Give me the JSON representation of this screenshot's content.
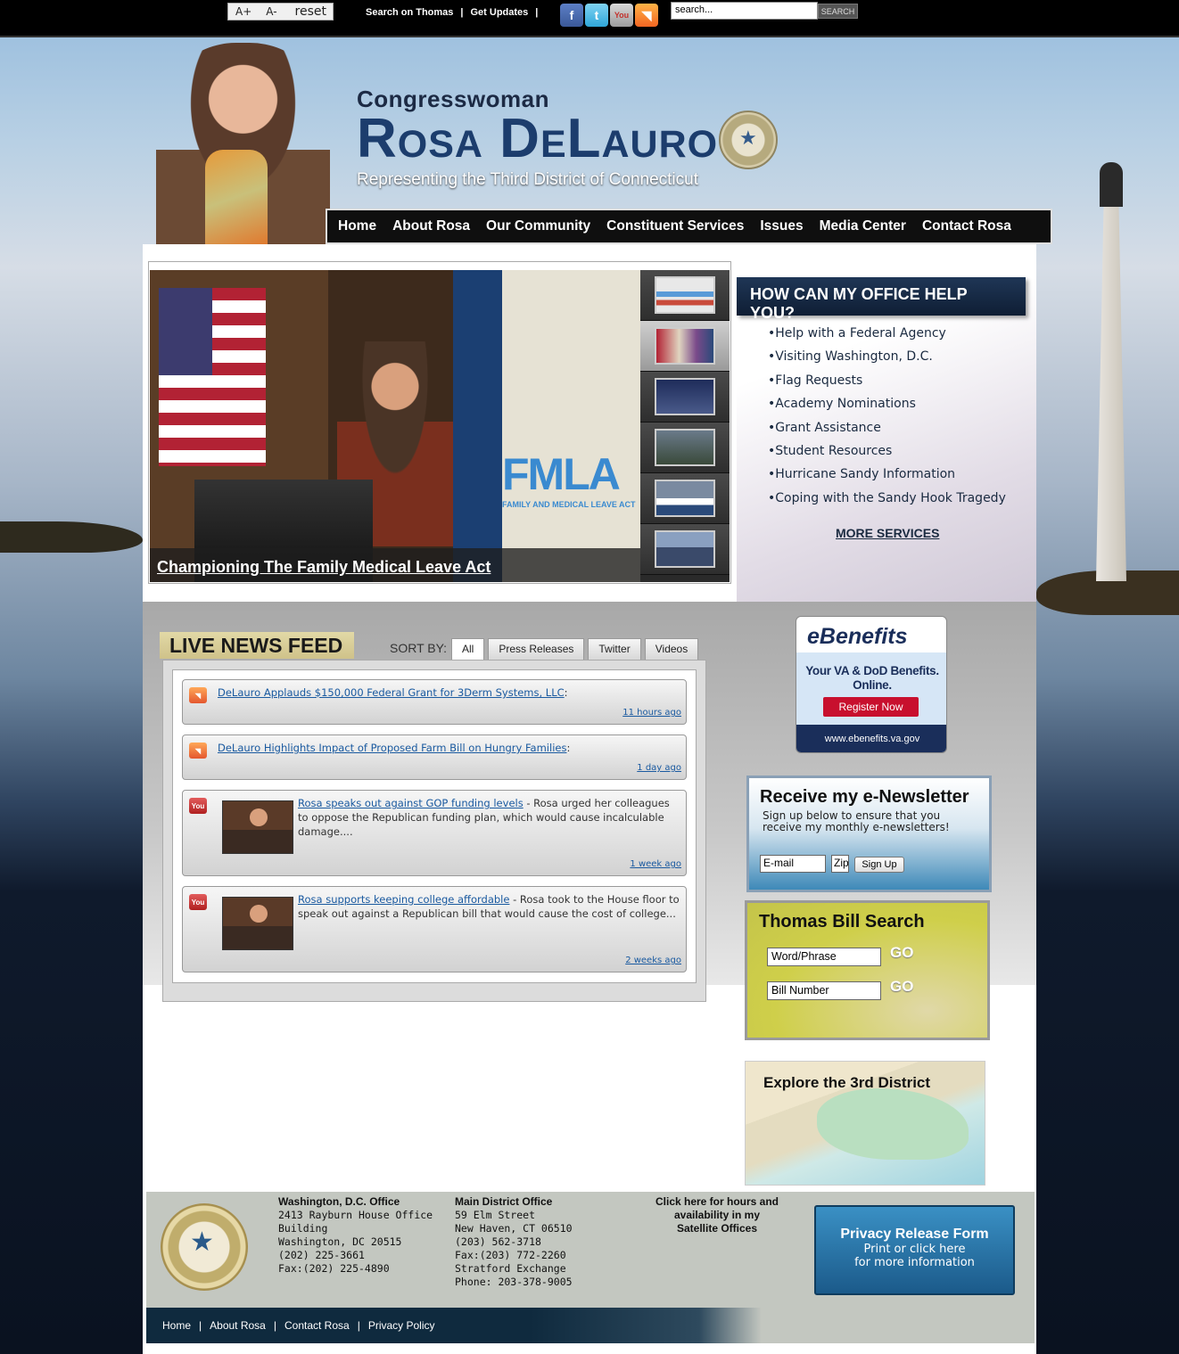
{
  "topbar": {
    "font_increase": "A+",
    "font_decrease": "A-",
    "font_reset": "reset",
    "links": [
      "Search on Thomas",
      "Get Updates"
    ],
    "social": [
      "facebook-icon",
      "twitter-icon",
      "youtube-icon",
      "rss-icon"
    ],
    "search_value": "search...",
    "search_button": "SEARCH"
  },
  "header": {
    "pre_title": "Congresswoman",
    "name": "Rosa DeLauro",
    "subtitle": "Representing the Third District of Connecticut"
  },
  "nav": [
    "Home",
    "About Rosa",
    "Our Community",
    "Constituent Services",
    "Issues",
    "Media Center",
    "Contact Rosa"
  ],
  "slideshow": {
    "caption": "Championing The Family Medical Leave Act",
    "overlay_text": "FMLA",
    "overlay_sub": "FAMILY AND MEDICAL LEAVE ACT",
    "thumbnails": 6,
    "active_thumb": 2
  },
  "help": {
    "title": "HOW CAN MY OFFICE HELP YOU?",
    "items": [
      "Help with a Federal Agency",
      "Visiting Washington, D.C.",
      "Flag Requests",
      "Academy Nominations",
      "Grant Assistance",
      "Student Resources",
      "Hurricane Sandy Information",
      "Coping with the Sandy Hook Tragedy"
    ],
    "more": "MORE SERVICES"
  },
  "newsfeed": {
    "title": "LIVE NEWS FEED",
    "sort_label": "SORT BY:",
    "tabs": [
      "All",
      "Press Releases",
      "Twitter",
      "Videos"
    ],
    "items": [
      {
        "type": "rss",
        "link": "DeLauro Applauds $150,000 Federal Grant for 3Derm Systems, LLC",
        "suffix": ":",
        "time": "11 hours ago"
      },
      {
        "type": "rss",
        "link": "DeLauro Highlights Impact of Proposed Farm Bill on Hungry Families",
        "suffix": ":",
        "time": "1 day ago"
      },
      {
        "type": "video",
        "link": "Rosa speaks out against GOP funding levels",
        "desc": " - Rosa urged her colleagues to oppose the Republican funding plan, which would cause incalculable damage....",
        "time": "1 week ago"
      },
      {
        "type": "video",
        "link": "Rosa supports keeping college affordable",
        "desc": " - Rosa took to the House floor to speak out against a Republican bill that would cause the cost of college...",
        "time": "2 weeks ago"
      }
    ]
  },
  "ebenefits": {
    "logo": "eBenefits",
    "tagline": "Your VA & DoD Benefits. Online.",
    "button": "Register Now",
    "url": "www.ebenefits.va.gov"
  },
  "newsletter": {
    "title": "Receive my e-Newsletter",
    "subtitle": "Sign up below to ensure that you receive my monthly e-newsletters!",
    "email_placeholder": "E-mail",
    "zip_placeholder": "Zip",
    "button": "Sign Up"
  },
  "bill_search": {
    "title": "Thomas Bill Search",
    "phrase_value": "Word/Phrase",
    "number_value": "Bill Number",
    "go": "GO"
  },
  "explore": {
    "title": "Explore the 3rd District"
  },
  "footer": {
    "dc": {
      "title": "Washington, D.C. Office",
      "lines": [
        "2413 Rayburn House Office",
        "Building",
        "Washington, DC 20515",
        "(202) 225-3661",
        "Fax:(202) 225-4890"
      ]
    },
    "district": {
      "title": "Main District Office",
      "lines": [
        "59 Elm Street",
        "New Haven, CT 06510",
        "(203) 562-3718",
        "Fax:(203) 772-2260",
        "Stratford Exchange",
        "Phone: 203-378-9005"
      ]
    },
    "satellite": "Click here for hours and availability in my Satellite Offices",
    "privacy": {
      "title": "Privacy Release Form",
      "line1": "Print or click here",
      "line2": "for more information"
    },
    "links": [
      "Home",
      "About Rosa",
      "Contact Rosa",
      "Privacy Policy"
    ]
  }
}
